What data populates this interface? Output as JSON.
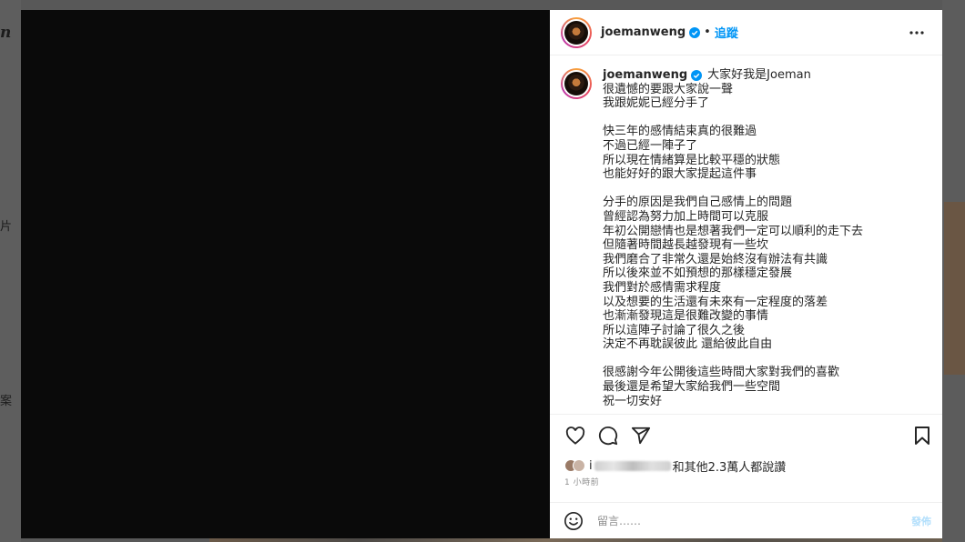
{
  "background": {
    "logo_fragment": "n",
    "fragment_1": "片",
    "fragment_2": "案"
  },
  "post": {
    "header": {
      "username": "joemanweng",
      "separator": "•",
      "follow_label": "追蹤",
      "verified_icon": "verified-badge-icon",
      "more_icon": "more-options-icon"
    },
    "caption": {
      "username": "joemanweng",
      "first_line": "大家好我是Joeman",
      "lines": [
        "很遺憾的要跟大家說一聲",
        "我跟妮妮已經分手了",
        "",
        "快三年的感情結束真的很難過",
        "不過已經一陣子了",
        "所以現在情緒算是比較平穩的狀態",
        "也能好好的跟大家提起這件事",
        "",
        "分手的原因是我們自己感情上的問題",
        "曾經認為努力加上時間可以克服",
        "年初公開戀情也是想著我們一定可以順利的走下去",
        "但隨著時間越長越發現有一些坎",
        "我們磨合了非常久還是始終沒有辦法有共識",
        "所以後來並不如預想的那樣穩定發展",
        "我們對於感情需求程度",
        "以及想要的生活還有未來有一定程度的落差",
        "也漸漸發現這是很難改變的事情",
        "所以這陣子討論了很久之後",
        "決定不再耽誤彼此 還給彼此自由",
        "",
        "很感謝今年公開後這些時間大家對我們的喜歡",
        "最後還是希望大家給我們一些空間",
        "祝一切安好"
      ]
    },
    "actions": {
      "like_icon": "heart-icon",
      "comment_icon": "comment-icon",
      "share_icon": "share-icon",
      "save_icon": "bookmark-icon"
    },
    "likes": {
      "prefix": "i",
      "suffix": "和其他2.3萬人都說讚"
    },
    "timestamp": "1 小時前",
    "comment_box": {
      "emoji_icon": "emoji-icon",
      "placeholder": "留言……",
      "post_label": "發佈"
    },
    "colors": {
      "link_blue": "#0095f6",
      "post_disabled": "#b2dffc",
      "verified_blue": "#0095f6"
    }
  }
}
